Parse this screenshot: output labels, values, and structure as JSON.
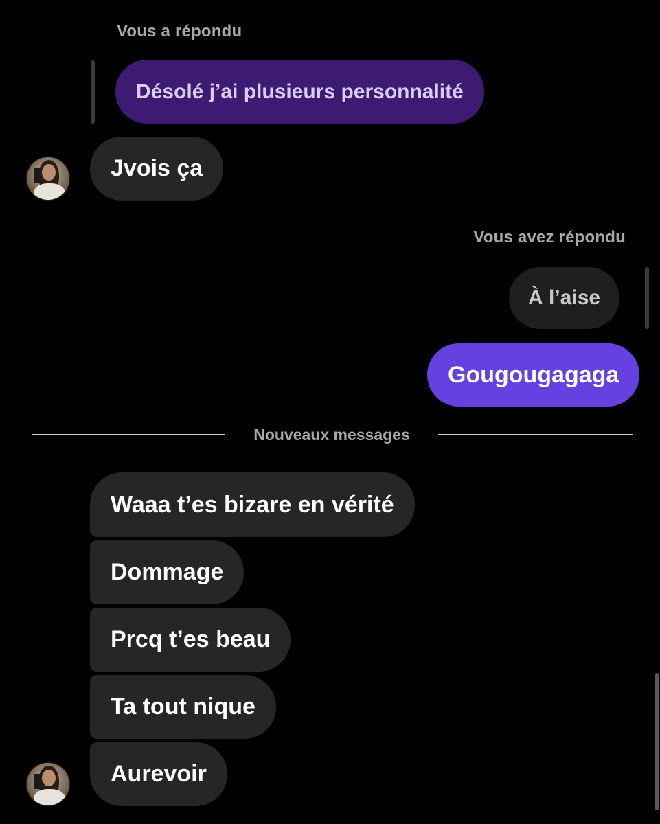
{
  "thread": {
    "incoming_reply_label": "Vous a répondu",
    "incoming_quoted_text": "Désolé j’ai plusieurs personnalité",
    "incoming_reply": "Jvois ça",
    "outgoing_reply_label": "Vous avez répondu",
    "outgoing_quoted_text": "À l’aise",
    "outgoing_message": "Gougougagaga",
    "divider_label": "Nouveaux messages",
    "new_messages": [
      "Waaa t’es bizare en vérité",
      "Dommage",
      "Prcq t’es beau",
      "Ta tout nique",
      "Aurevoir"
    ]
  },
  "colors": {
    "background": "#000000",
    "incoming_bubble": "#262626",
    "outgoing_bubble": "#6441e0",
    "quoted_outgoing_bubble": "#3d1b73",
    "label_grey": "#a8a8a8"
  },
  "icons": {
    "avatar": "contact-avatar-photo"
  }
}
